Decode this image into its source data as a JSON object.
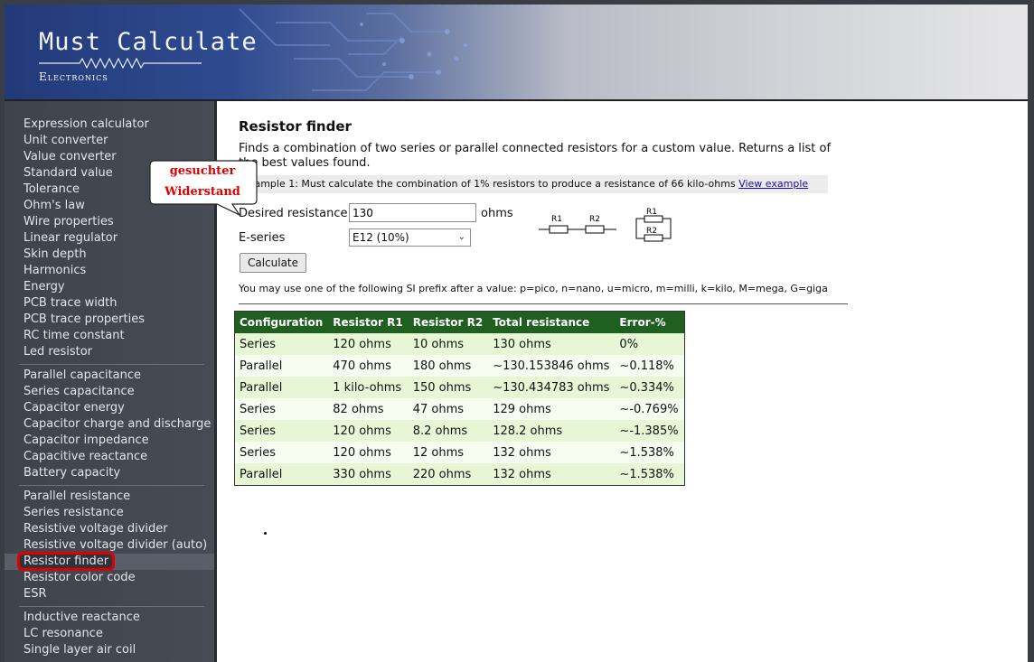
{
  "header": {
    "title": "Must Calculate",
    "subtitle": "Electronics",
    "colors": {
      "header_left": "#233a78",
      "header_right": "#e6e6e8"
    }
  },
  "sidebar": {
    "groups": [
      [
        "Expression calculator",
        "Unit converter",
        "Value converter",
        "Standard value",
        "Tolerance",
        "Ohm's law",
        "Wire properties",
        "Linear regulator",
        "Skin depth",
        "Harmonics",
        "Energy",
        "PCB trace width",
        "PCB trace properties",
        "RC time constant",
        "Led resistor"
      ],
      [
        "Parallel capacitance",
        "Series capacitance",
        "Capacitor energy",
        "Capacitor charge and discharge",
        "Capacitor impedance",
        "Capacitive reactance",
        "Battery capacity"
      ],
      [
        "Parallel resistance",
        "Series resistance",
        "Resistive voltage divider",
        "Resistive voltage divider (auto)",
        "Resistor finder",
        "Resistor color code",
        "ESR"
      ],
      [
        "Inductive reactance",
        "LC resonance",
        "Single layer air coil"
      ]
    ],
    "active": "Resistor finder"
  },
  "main": {
    "title": "Resistor finder",
    "intro": "Finds a combination of two series or parallel connected resistors for a custom value. Returns a list of the best values found.",
    "example_text": "Example 1: Must calculate the combination of 1% resistors to produce a resistance of 66 kilo-ohms",
    "example_link": "View example",
    "desired_label": "Desired resistance",
    "desired_value": "130",
    "desired_unit": "ohms",
    "eseries_label": "E-series",
    "eseries_value": "E12 (10%)",
    "calculate_label": "Calculate",
    "si_note": "You may use one of the following SI prefix after a value: p=pico, n=nano, u=micro, m=milli, k=kilo, M=mega, G=giga",
    "diagram": {
      "r1": "R1",
      "r2": "R2"
    }
  },
  "table": {
    "headers": [
      "Configuration",
      "Resistor R1",
      "Resistor R2",
      "Total resistance",
      "Error-%"
    ],
    "rows": [
      [
        "Series",
        "120 ohms",
        "10 ohms",
        "130 ohms",
        "0%"
      ],
      [
        "Parallel",
        "470 ohms",
        "180 ohms",
        "~130.153846 ohms",
        "~0.118%"
      ],
      [
        "Parallel",
        "1 kilo-ohms",
        "150 ohms",
        "~130.434783 ohms",
        "~0.334%"
      ],
      [
        "Series",
        "82 ohms",
        "47 ohms",
        "129 ohms",
        "~-0.769%"
      ],
      [
        "Series",
        "120 ohms",
        "8.2 ohms",
        "128.2 ohms",
        "~-1.385%"
      ],
      [
        "Series",
        "120 ohms",
        "12 ohms",
        "132 ohms",
        "~1.538%"
      ],
      [
        "Parallel",
        "330 ohms",
        "220 ohms",
        "132 ohms",
        "~1.538%"
      ]
    ],
    "colors": {
      "header_bg": "#1f5f1f",
      "row_odd": "#e7f7d6",
      "row_even": "#f7fcf0"
    }
  },
  "callout": {
    "line1": "gesuchter",
    "line2": "Widerstand",
    "color": "#e00000"
  }
}
